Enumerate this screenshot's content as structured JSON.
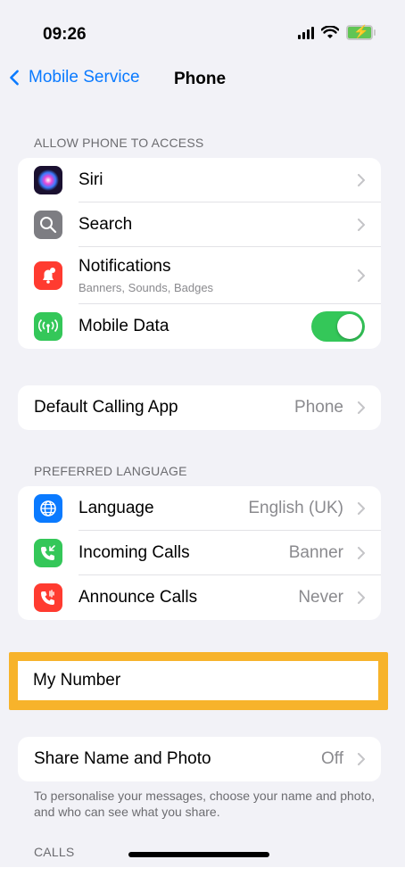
{
  "status": {
    "time": "09:26"
  },
  "nav": {
    "back_label": "Mobile Service",
    "title": "Phone"
  },
  "sections": {
    "access_header": "ALLOW PHONE TO ACCESS",
    "access_items": [
      {
        "label": "Siri",
        "icon": "siri-icon"
      },
      {
        "label": "Search",
        "icon": "search-icon"
      },
      {
        "label": "Notifications",
        "sublabel": "Banners, Sounds, Badges",
        "icon": "notifications-icon"
      },
      {
        "label": "Mobile Data",
        "icon": "mobile-data-icon",
        "toggle": "on"
      }
    ],
    "default_calling": {
      "label": "Default Calling App",
      "value": "Phone"
    },
    "language_header": "PREFERRED LANGUAGE",
    "language_items": [
      {
        "label": "Language",
        "value": "English (UK)",
        "icon": "globe-icon"
      },
      {
        "label": "Incoming Calls",
        "value": "Banner",
        "icon": "incoming-call-icon"
      },
      {
        "label": "Announce Calls",
        "value": "Never",
        "icon": "announce-call-icon"
      }
    ],
    "my_number": {
      "label": "My Number"
    },
    "share": {
      "label": "Share Name and Photo",
      "value": "Off"
    },
    "share_footer": "To personalise your messages, choose your name and photo, and who can see what you share.",
    "calls_header": "CALLS"
  },
  "colors": {
    "accent": "#0a7aff",
    "toggle_on": "#34c759",
    "highlight": "#f7b32b"
  }
}
